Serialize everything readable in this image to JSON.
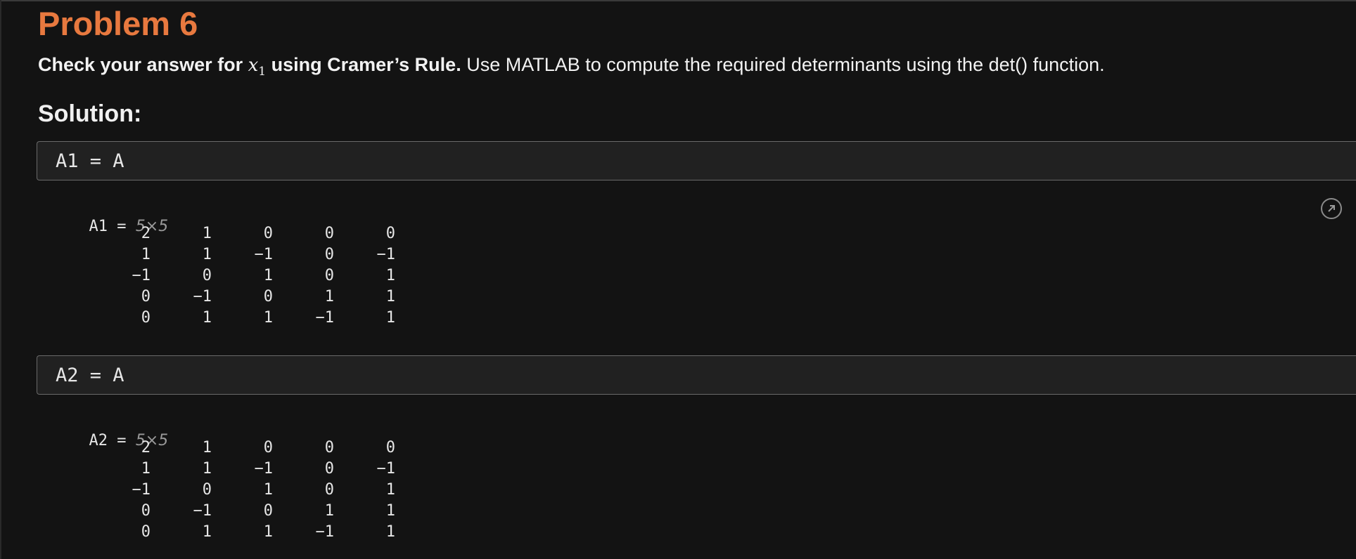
{
  "problem": {
    "title": "Problem 6",
    "desc_bold_prefix": "Check your answer for",
    "desc_var": "x",
    "desc_var_sub": "1",
    "desc_bold_suffix": " using Cramer’s Rule.",
    "desc_rest": " Use MATLAB to compute the required determinants using the det() function."
  },
  "solution_label": "Solution:",
  "blocks": [
    {
      "code": "A1 = A",
      "output_name": "A1 = ",
      "output_size": "5×5",
      "matrix": [
        [
          "2",
          "1",
          "0",
          "0",
          "0"
        ],
        [
          "1",
          "1",
          "−1",
          "0",
          "−1"
        ],
        [
          "−1",
          "0",
          "1",
          "0",
          "1"
        ],
        [
          "0",
          "−1",
          "0",
          "1",
          "1"
        ],
        [
          "0",
          "1",
          "1",
          "−1",
          "1"
        ]
      ]
    },
    {
      "code": "A2 = A",
      "output_name": "A2 = ",
      "output_size": "5×5",
      "matrix": [
        [
          "2",
          "1",
          "0",
          "0",
          "0"
        ],
        [
          "1",
          "1",
          "−1",
          "0",
          "−1"
        ],
        [
          "−1",
          "0",
          "1",
          "0",
          "1"
        ],
        [
          "0",
          "−1",
          "0",
          "1",
          "1"
        ],
        [
          "0",
          "1",
          "1",
          "−1",
          "1"
        ]
      ]
    }
  ],
  "icons": {
    "expand": "open-in-new-icon"
  }
}
